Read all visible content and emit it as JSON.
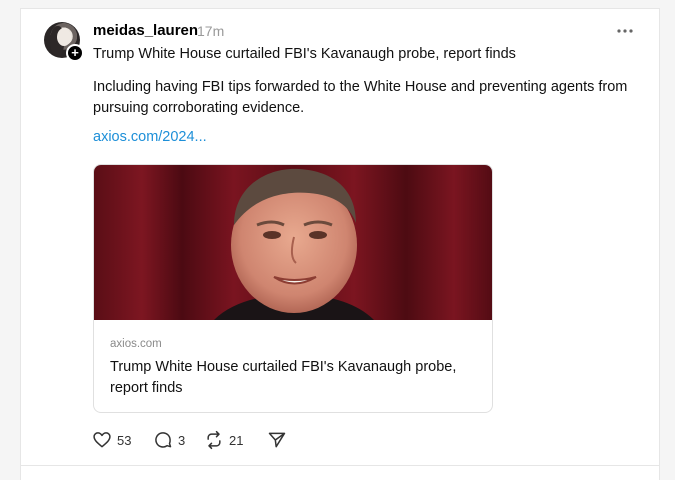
{
  "post": {
    "username": "meidas_lauren",
    "timestamp": "17m",
    "more_icon": "more-horizontal-icon",
    "title": "Trump White House curtailed FBI's Kavanaugh probe, report finds",
    "body": "Including having FBI tips forwarded to the White House and preventing agents from pursuing corroborating evidence.",
    "link_text": "axios.com/2024...",
    "link_color": "#1d8fd8"
  },
  "link_card": {
    "domain": "axios.com",
    "title": "Trump White House curtailed FBI's Kavanaugh probe, report finds",
    "image_subject": "portrait photo of a man smiling in front of a red curtain"
  },
  "actions": {
    "likes": "53",
    "comments": "3",
    "reposts": "21",
    "like_icon": "heart-icon",
    "comment_icon": "comment-icon",
    "repost_icon": "repost-icon",
    "share_icon": "send-icon"
  }
}
